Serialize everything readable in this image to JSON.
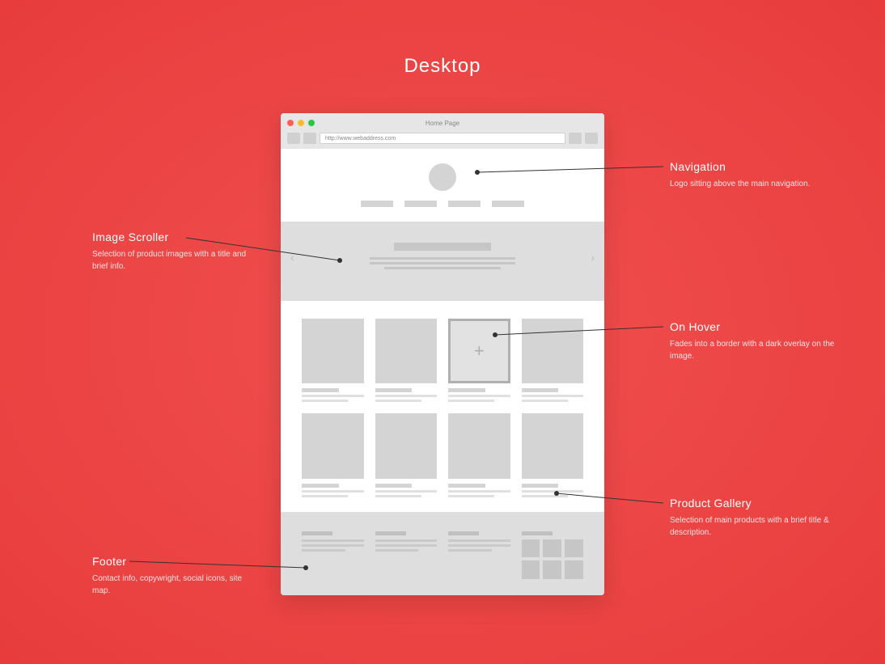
{
  "page_title": "Desktop",
  "browser": {
    "tab_title": "Home Page",
    "url": "http://www.webaddress.com"
  },
  "annotations": {
    "navigation": {
      "title": "Navigation",
      "desc": "Logo sitting above the main navigation."
    },
    "scroller": {
      "title": "Image Scroller",
      "desc": "Selection of product images with a title and brief info."
    },
    "hover": {
      "title": "On Hover",
      "desc": "Fades into a border with a dark overlay on the image."
    },
    "gallery": {
      "title": "Product Gallery",
      "desc": "Selection of main products with a brief title & description."
    },
    "footer": {
      "title": "Footer",
      "desc": "Contact info, copywright, social icons, site map."
    }
  },
  "hover_symbol": "+"
}
